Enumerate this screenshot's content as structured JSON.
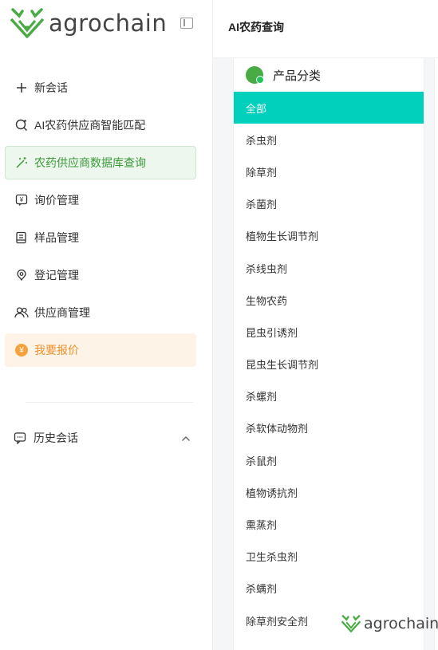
{
  "brand": {
    "name": "agrochain",
    "accent": "#4aaa45"
  },
  "sidebar": {
    "items": [
      {
        "label": "新会话",
        "icon": "plus-icon"
      },
      {
        "label": "AI农药供应商智能匹配",
        "icon": "ai-search-icon"
      },
      {
        "label": "农药供应商数据库查询",
        "icon": "magic-wand-icon",
        "active": true
      },
      {
        "label": "询价管理",
        "icon": "price-chat-icon"
      },
      {
        "label": "样品管理",
        "icon": "sample-book-icon"
      },
      {
        "label": "登记管理",
        "icon": "register-icon"
      },
      {
        "label": "供应商管理",
        "icon": "users-icon"
      },
      {
        "label": "我要报价",
        "icon": "yen-coin-icon",
        "highlight": "#f0902b"
      }
    ],
    "history_label": "历史会话"
  },
  "header": {
    "title": "AI农药查询"
  },
  "panel": {
    "title": "产品分类",
    "selected_color": "#00d0bc",
    "categories": [
      "全部",
      "杀虫剂",
      "除草剂",
      "杀菌剂",
      "植物生长调节剂",
      "杀线虫剂",
      "生物农药",
      "昆虫引诱剂",
      "昆虫生长调节剂",
      "杀螺剂",
      "杀软体动物剂",
      "杀鼠剂",
      "植物诱抗剂",
      "熏蒸剂",
      "卫生杀虫剂",
      "杀螨剂",
      "除草剂安全剂"
    ]
  },
  "watermark": {
    "text": "agrochain"
  }
}
